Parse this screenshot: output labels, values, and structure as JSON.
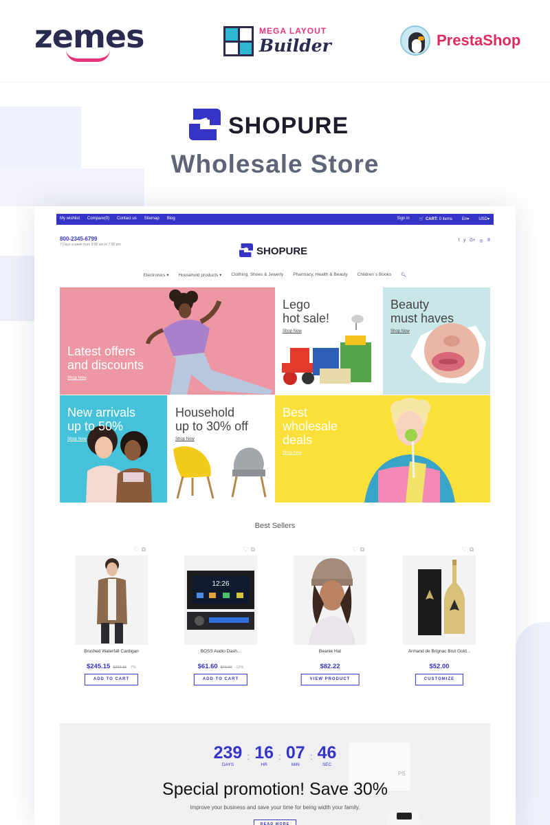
{
  "brands": {
    "zemes": "zemes",
    "mega_layout_top": "MEGA LAYOUT",
    "mega_layout_bottom": "Builder",
    "prestashop": "PrestaShop"
  },
  "hero": {
    "logo": "SHOPURE",
    "subtitle": "Wholesale Store"
  },
  "store": {
    "top_links": [
      "My wishlist",
      "Compare(0)",
      "Contact us",
      "Sitemap",
      "Blog"
    ],
    "sign_in": "Sign in",
    "cart_label": "CART:",
    "cart_items": "0 items",
    "language": "En",
    "currency": "USD",
    "phone": "800-2345-6799",
    "hours": "7 Days a week from 9:00 am to 7:00 pm",
    "logo": "SHOPURE",
    "social": [
      "f",
      "y",
      "G+",
      "◎",
      "®"
    ],
    "categories": [
      "Electronics",
      "Household products",
      "Clothing, Shoes & Jewerly",
      "Pharmacy, Health & Beauty",
      "Children`s Books"
    ],
    "banners": {
      "latest": {
        "title_1": "Latest offers",
        "title_2": "and discounts",
        "link": "Shop Now"
      },
      "lego": {
        "title_1": "Lego",
        "title_2": "hot sale!",
        "link": "Shop Now"
      },
      "beauty": {
        "title_1": "Beauty",
        "title_2": "must haves",
        "link": "Shop Now"
      },
      "arrivals": {
        "title_1": "New arrivals",
        "title_2": "up to 50%",
        "link": "Shop Now"
      },
      "household": {
        "title_1": "Household",
        "title_2": "up to 30% off",
        "link": "Shop Now"
      },
      "wholesale": {
        "title_1": "Best",
        "title_2": "wholesale",
        "title_3": "deals",
        "link": "Shop Now"
      }
    },
    "best_sellers_title": "Best Sellers",
    "products": [
      {
        "name": "Brushed Waterfall Cardigan",
        "price": "$245.15",
        "old_price": "$262.15",
        "discount": "-7%",
        "button": "ADD TO CART"
      },
      {
        "name": "BOSS Audio Dash...",
        "price": "$61.60",
        "old_price": "$70.00",
        "discount": "-12%",
        "button": "ADD TO CART"
      },
      {
        "name": "Beanie Hat",
        "price": "$82.22",
        "old_price": "",
        "discount": "",
        "button": "VIEW PRODUCT"
      },
      {
        "name": "Armand de Brignac Brut Gold...",
        "price": "$52.00",
        "old_price": "",
        "discount": "",
        "button": "CUSTOMIZE"
      }
    ],
    "promo": {
      "days": "239",
      "days_label": "DAYS",
      "hours": "16",
      "hours_label": "HR",
      "minutes": "07",
      "minutes_label": "MIN",
      "seconds": "46",
      "seconds_label": "SEC",
      "separator": ":",
      "title": "Special promotion! Save 30%",
      "subtitle": "Improve your business and save your time for being width your family.",
      "button": "READ MORE"
    }
  },
  "colors": {
    "accent": "#3634c7",
    "zemes_pink": "#e7357f",
    "presta_red": "#dd2b5f",
    "navy": "#2b2b52"
  }
}
